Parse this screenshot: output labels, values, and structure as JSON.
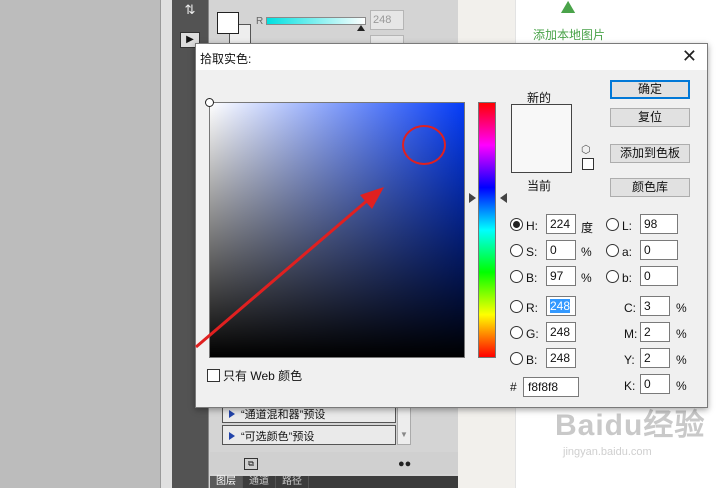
{
  "background": {
    "panel_slider": {
      "channel_label": "R",
      "value": "248"
    },
    "presets": [
      {
        "label": "“通道混和器”预设"
      },
      {
        "label": "“可选颜色”预设"
      }
    ],
    "bottom_tabs": [
      "图层",
      "通道",
      "路径"
    ],
    "upload_label": "添加本地图片",
    "watermark": "Baidu经验",
    "watermark_sub": "jingyan.baidu.com"
  },
  "dialog": {
    "title": "拾取实色:",
    "close_glyph": "✕",
    "label_new": "新的",
    "label_current": "当前",
    "new_color": "#f8f8f8",
    "current_color": "#f8f8f8",
    "buttons": {
      "ok": "确定",
      "reset": "复位",
      "add_swatch": "添加到色板",
      "color_library": "颜色库"
    },
    "hsb": {
      "H": {
        "label": "H:",
        "value": "224",
        "unit": "度",
        "selected": true
      },
      "S": {
        "label": "S:",
        "value": "0",
        "unit": "%"
      },
      "B": {
        "label": "B:",
        "value": "97",
        "unit": "%"
      }
    },
    "rgb": {
      "R": {
        "label": "R:",
        "value": "248"
      },
      "G": {
        "label": "G:",
        "value": "248"
      },
      "B": {
        "label": "B:",
        "value": "248"
      }
    },
    "lab": {
      "L": {
        "label": "L:",
        "value": "98"
      },
      "a": {
        "label": "a:",
        "value": "0"
      },
      "b": {
        "label": "b:",
        "value": "0"
      }
    },
    "cmyk": {
      "C": {
        "label": "C:",
        "value": "3",
        "unit": "%"
      },
      "M": {
        "label": "M:",
        "value": "2",
        "unit": "%"
      },
      "Y": {
        "label": "Y:",
        "value": "2",
        "unit": "%"
      },
      "K": {
        "label": "K:",
        "value": "0",
        "unit": "%"
      }
    },
    "hex": {
      "label": "#",
      "value": "f8f8f8"
    },
    "web_only_label": "只有 Web 颜色",
    "hue_base_color": "#053cf8",
    "annotation_color": "#e02020"
  }
}
